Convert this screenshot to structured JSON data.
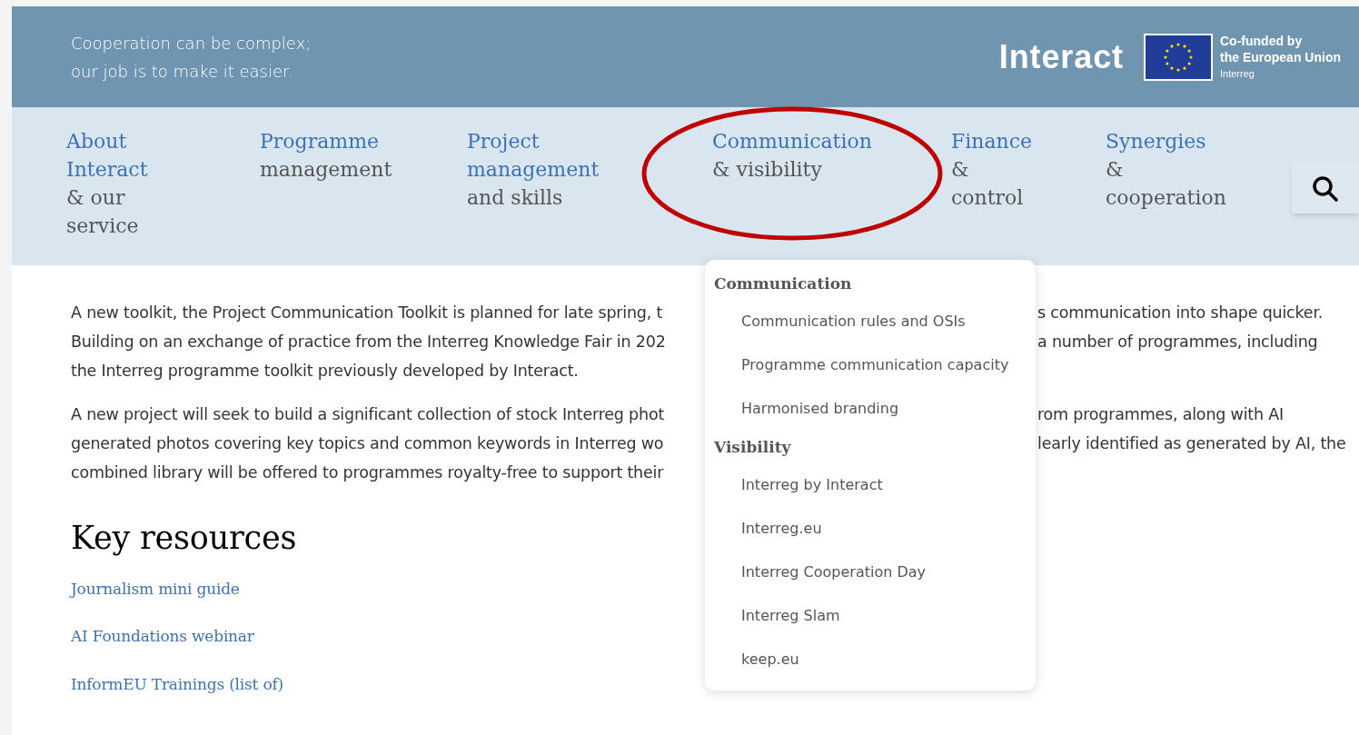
{
  "header": {
    "tagline": [
      "Cooperation can be complex;",
      "our job is to make it easier."
    ],
    "logo": "Interact",
    "eu_label": [
      "Co-funded by",
      "the European Union"
    ],
    "eu_sub": "Interreg"
  },
  "nav": [
    {
      "title": [
        "About",
        "Interact"
      ],
      "sub": [
        "& our",
        "service"
      ]
    },
    {
      "title": [
        "Programme"
      ],
      "sub": [
        "management"
      ]
    },
    {
      "title": [
        "Project",
        "management"
      ],
      "sub": [
        "and skills"
      ]
    },
    {
      "title": [
        "Communication"
      ],
      "sub": [
        "& visibility"
      ]
    },
    {
      "title": [
        "Finance"
      ],
      "sub": [
        "&",
        "control"
      ]
    },
    {
      "title": [
        "Synergies"
      ],
      "sub": [
        "&",
        "cooperation"
      ]
    }
  ],
  "dropdown": {
    "groups": [
      {
        "heading": "Communication",
        "items": [
          "Communication rules and OSIs",
          "Programme communication capacity",
          "Harmonised branding"
        ]
      },
      {
        "heading": "Visibility",
        "items": [
          "Interreg by Interact",
          "Interreg.eu",
          "Interreg Cooperation Day",
          "Interreg Slam",
          "keep.eu"
        ]
      }
    ]
  },
  "body": {
    "paragraphs": [
      [
        {
          "left": "A new toolkit, the Project Communication Toolkit is planned for late spring, t",
          "right": "s communication into shape quicker."
        },
        {
          "left": "Building on an exchange of practice from the Interreg Knowledge Fair in 202",
          "right": "a number of programmes, including"
        },
        {
          "left": "the Interreg programme toolkit previously developed by Interact."
        }
      ],
      [
        {
          "left": "A new project will seek to build a significant collection of stock Interreg phot",
          "right": "rom programmes, along with AI"
        },
        {
          "left": "generated photos covering key topics and common keywords in Interreg wo",
          "right": "learly identified as generated by AI, the"
        },
        {
          "left": "combined library will be offered to programmes royalty-free to support their"
        }
      ]
    ],
    "heading": "Key resources",
    "links": [
      "Journalism mini guide",
      "AI Foundations webinar",
      "InformEU Trainings (list of)"
    ]
  }
}
